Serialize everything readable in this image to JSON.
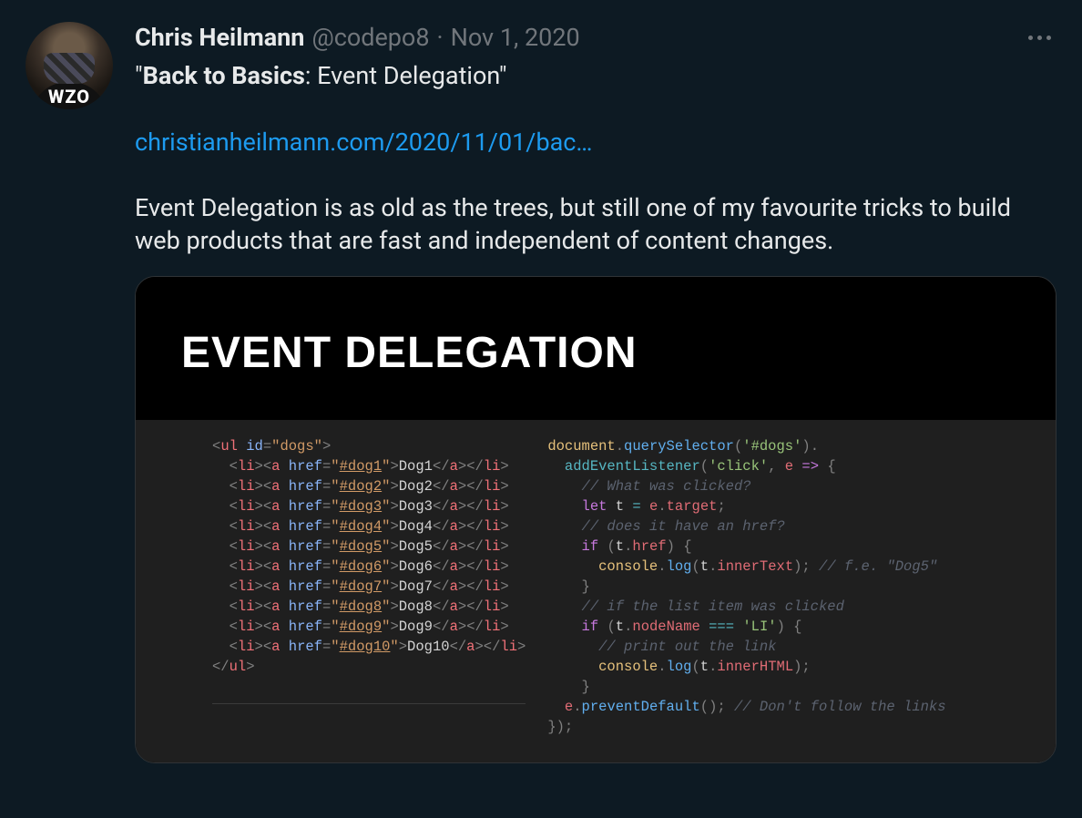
{
  "tweet": {
    "author": {
      "display_name": "Chris Heilmann",
      "handle": "@codepo8",
      "shirt_text": "WZO"
    },
    "separator": "·",
    "date": "Nov 1, 2020",
    "text": {
      "line1_prefix": "\"",
      "line1_bold": "Back to Basics",
      "line1_rest": ": Event Delegation\"",
      "link": "christianheilmann.com/2020/11/01/bac…",
      "para": "Event Delegation is as old as the trees, but still one of my favourite tricks to build web products that are fast and independent of content changes."
    }
  },
  "card": {
    "title": "EVENT DELEGATION",
    "html_list": {
      "open": "<ul id=\"dogs\">",
      "items": [
        {
          "href": "#dog1",
          "label": "Dog1"
        },
        {
          "href": "#dog2",
          "label": "Dog2"
        },
        {
          "href": "#dog3",
          "label": "Dog3"
        },
        {
          "href": "#dog4",
          "label": "Dog4"
        },
        {
          "href": "#dog5",
          "label": "Dog5"
        },
        {
          "href": "#dog6",
          "label": "Dog6"
        },
        {
          "href": "#dog7",
          "label": "Dog7"
        },
        {
          "href": "#dog8",
          "label": "Dog8"
        },
        {
          "href": "#dog9",
          "label": "Dog9"
        },
        {
          "href": "#dog10",
          "label": "Dog10"
        }
      ],
      "close": "</ul>"
    },
    "js_lines": [
      {
        "t": "call",
        "raw": "document.querySelector('#dogs')."
      },
      {
        "t": "call2",
        "raw": "  addEventListener('click', e => {"
      },
      {
        "t": "comment",
        "raw": "    // What was clicked?"
      },
      {
        "t": "let",
        "raw": "    let t = e.target;"
      },
      {
        "t": "comment",
        "raw": "    // does it have an href?"
      },
      {
        "t": "if",
        "raw": "    if (t.href) {"
      },
      {
        "t": "log",
        "raw": "      console.log(t.innerText); // f.e. \"Dog5\""
      },
      {
        "t": "close",
        "raw": "    }"
      },
      {
        "t": "comment",
        "raw": "    // if the list item was clicked"
      },
      {
        "t": "if2",
        "raw": "    if (t.nodeName === 'LI') {"
      },
      {
        "t": "comment",
        "raw": "      // print out the link"
      },
      {
        "t": "log2",
        "raw": "      console.log(t.innerHTML);"
      },
      {
        "t": "close",
        "raw": "    }"
      },
      {
        "t": "prevent",
        "raw": "  e.preventDefault(); // Don't follow the links"
      },
      {
        "t": "end",
        "raw": "});"
      }
    ]
  }
}
